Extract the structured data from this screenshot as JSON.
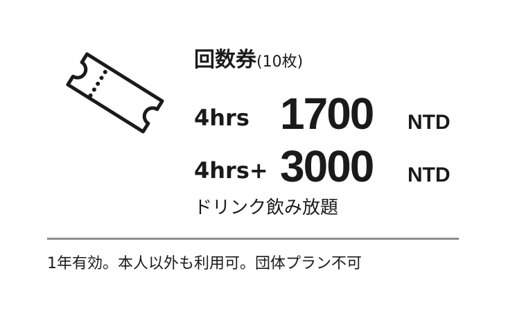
{
  "title": {
    "main": "回数券",
    "sub": "(10枚)"
  },
  "prices": [
    {
      "duration": "4hrs",
      "amount": "1700",
      "unit": "NTD"
    },
    {
      "duration": "4hrs+",
      "amount": "3000",
      "unit": "NTD"
    }
  ],
  "note": "ドリンク飲み放題",
  "footer": "1年有効。本人以外も利用可。団体プラン不可",
  "icons": {
    "ticket": "ticket-icon"
  },
  "colors": {
    "text": "#1a1a1a",
    "divider": "#8c8c8c",
    "background": "#ffffff"
  }
}
